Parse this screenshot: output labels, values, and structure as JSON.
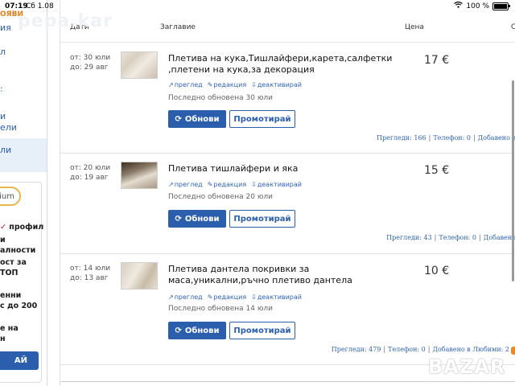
{
  "status_bar": {
    "time": "07:19",
    "date": "Сб 1.08",
    "battery": "100 %"
  },
  "watermark": "pepa.kar",
  "sidebar": {
    "brand_fragment": "ОЯВИ",
    "items": [
      "ия",
      "л",
      ":",
      "и",
      "ели",
      "ли"
    ],
    "premium_fragment": "ium",
    "promo_lines": [
      "профил",
      "и",
      "алности",
      "ост за",
      "ТОП",
      "енни",
      "с до 200",
      "е на",
      "н"
    ],
    "promo_button": "АЙ"
  },
  "table_header": {
    "date": "Дати",
    "title": "Заглавие",
    "price": "Цена",
    "extra": "С"
  },
  "actions": {
    "view": "преглед",
    "edit": "редакция",
    "deactivate": "деактивирай",
    "renew": "Обнови",
    "promote": "Промотирай"
  },
  "listings": [
    {
      "from": "от: 30 юли",
      "to": "до: 29 авг",
      "title": "Плетива на кука,Тишлайфери,карета,салфетки ,плетени на кука,за декорация",
      "price": "17 €",
      "updated": "Последно обновена 30 юли",
      "views": "Прегледи: 166",
      "phone": "Телефон: 0",
      "added": "Добавено в"
    },
    {
      "from": "от: 20 юли",
      "to": "до: 19 авг",
      "title": "Плетива тишлайфери и яка",
      "price": "15 €",
      "updated": "Последно обновена 20 юли",
      "views": "Прегледи: 43",
      "phone": "Телефон: 0",
      "added": "Добавено"
    },
    {
      "from": "от: 14 юли",
      "to": "до: 13 авг",
      "title": "Плетива дантела покривки за маса,уникални,ръчно плетиво дантела",
      "price": "10 €",
      "updated": "Последно обновена 14 юли",
      "views": "Прегледи: 479",
      "phone": "Телефон: 0",
      "added": "Добавено в Любими: 2"
    }
  ],
  "logo_text": "BAZAR"
}
